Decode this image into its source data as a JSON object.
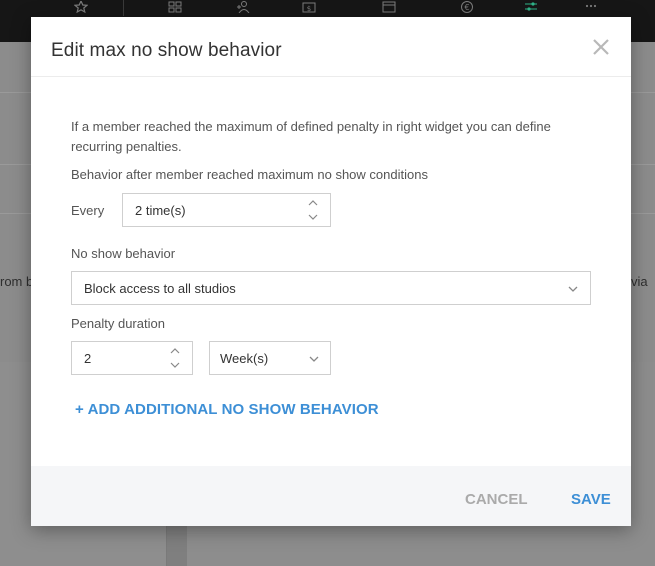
{
  "background": {
    "left_fragment": "rom b",
    "right_fragment": "via",
    "top_icons": [
      "star-icon",
      "grid-icon",
      "person-add-icon",
      "wallet-icon",
      "calendar-icon",
      "euro-icon",
      "sliders-icon",
      "more-icon"
    ]
  },
  "modal": {
    "title": "Edit max no show behavior",
    "intro": "If a member reached the maximum of defined penalty in right widget you can define recurring penalties.",
    "behavior_heading": "Behavior after member reached maximum no show conditions",
    "every_label": "Every",
    "every_value": "2 time(s)",
    "no_show_label": "No show behavior",
    "no_show_value": "Block access to all studios",
    "penalty_label": "Penalty duration",
    "penalty_value": "2",
    "penalty_unit": "Week(s)",
    "add_link": "+ ADD ADDITIONAL NO SHOW BEHAVIOR",
    "cancel": "CANCEL",
    "save": "SAVE"
  },
  "colors": {
    "accent": "#3d8fd6",
    "overlay": "#8a8a8a",
    "topbar": "#161616",
    "active_icon": "#2fb58a"
  }
}
